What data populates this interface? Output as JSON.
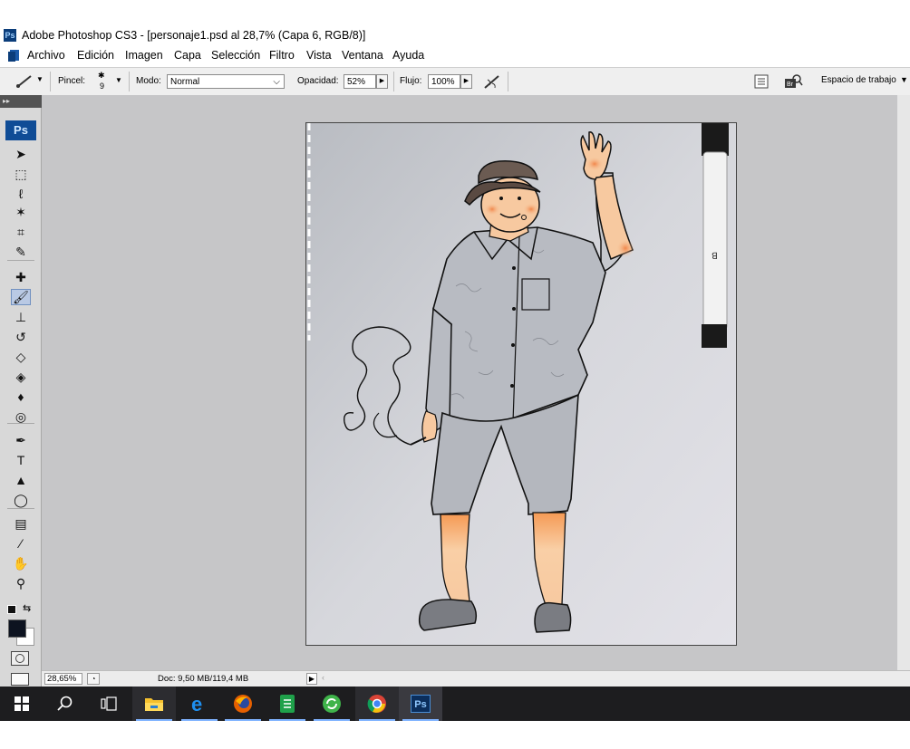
{
  "window": {
    "app_badge": "Ps",
    "title": "Adobe Photoshop CS3 - [personaje1.psd al 28,7% (Capa 6, RGB/8)]"
  },
  "menu": {
    "items": [
      "Archivo",
      "Edición",
      "Imagen",
      "Capa",
      "Selección",
      "Filtro",
      "Vista",
      "Ventana",
      "Ayuda"
    ]
  },
  "options_bar": {
    "brush_label": "Pincel:",
    "brush_size": "9",
    "mode_label": "Modo:",
    "mode_value": "Normal",
    "opacity_label": "Opacidad:",
    "opacity_value": "52%",
    "flow_label": "Flujo:",
    "flow_value": "100%",
    "workspace_label": "Espacio de trabajo"
  },
  "toolbox": {
    "logo": "Ps",
    "tools": [
      {
        "name": "move-tool-icon",
        "glyph": "➤",
        "selected": false
      },
      {
        "name": "marquee-tool-icon",
        "glyph": "⬚",
        "selected": false
      },
      {
        "name": "lasso-tool-icon",
        "glyph": "ℓ",
        "selected": false
      },
      {
        "name": "magic-wand-tool-icon",
        "glyph": "✶",
        "selected": false
      },
      {
        "name": "crop-tool-icon",
        "glyph": "⌗",
        "selected": false
      },
      {
        "name": "slice-tool-icon",
        "glyph": "✎",
        "selected": false
      },
      {
        "name": "healing-brush-tool-icon",
        "glyph": "✚",
        "selected": false
      },
      {
        "name": "brush-tool-icon",
        "glyph": "🖌",
        "selected": true
      },
      {
        "name": "clone-stamp-tool-icon",
        "glyph": "⊥",
        "selected": false
      },
      {
        "name": "history-brush-tool-icon",
        "glyph": "↺",
        "selected": false
      },
      {
        "name": "eraser-tool-icon",
        "glyph": "◇",
        "selected": false
      },
      {
        "name": "paint-bucket-tool-icon",
        "glyph": "◈",
        "selected": false
      },
      {
        "name": "blur-tool-icon",
        "glyph": "♦",
        "selected": false
      },
      {
        "name": "dodge-tool-icon",
        "glyph": "◎",
        "selected": false
      },
      {
        "name": "pen-tool-icon",
        "glyph": "✒",
        "selected": false
      },
      {
        "name": "type-tool-icon",
        "glyph": "T",
        "selected": false
      },
      {
        "name": "path-selection-tool-icon",
        "glyph": "▲",
        "selected": false
      },
      {
        "name": "ellipse-tool-icon",
        "glyph": "◯",
        "selected": false
      },
      {
        "name": "notes-tool-icon",
        "glyph": "▤",
        "selected": false
      },
      {
        "name": "eyedropper-tool-icon",
        "glyph": "⁄",
        "selected": false
      },
      {
        "name": "hand-tool-icon",
        "glyph": "✋",
        "selected": false
      },
      {
        "name": "zoom-tool-icon",
        "glyph": "⚲",
        "selected": false
      }
    ],
    "foreground_color": "#0d1320",
    "background_color": "#ffffff"
  },
  "status_bar": {
    "zoom": "28,65%",
    "doc_info": "Doc: 9,50 MB/119,4 MB"
  },
  "taskbar": {
    "items": [
      {
        "name": "start-button-icon"
      },
      {
        "name": "search-icon"
      },
      {
        "name": "task-view-icon"
      },
      {
        "name": "file-explorer-icon"
      },
      {
        "name": "edge-browser-icon"
      },
      {
        "name": "firefox-icon"
      },
      {
        "name": "notes-app-icon"
      },
      {
        "name": "sync-app-icon"
      },
      {
        "name": "chrome-icon"
      },
      {
        "name": "photoshop-taskbar-icon",
        "label": "Ps"
      }
    ]
  },
  "colors": {
    "workspace_bg": "#c6c6c8",
    "skin": "#f7c9a0",
    "cheek": "#f39a5c",
    "accent": "#0f4c96"
  }
}
